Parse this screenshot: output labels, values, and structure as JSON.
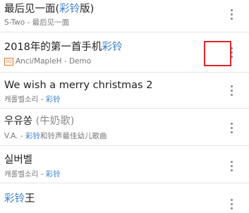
{
  "songs": [
    {
      "title_main": "最后见一面(",
      "title_hl": "彩铃",
      "title_tail": "版)",
      "subtitle_main": "S-Two - 最后见一面",
      "subtitle_hl": "",
      "subtitle_tail": ""
    },
    {
      "title_main": "2018年的第一首手机",
      "title_hl": "彩铃",
      "title_tail": "",
      "badge": "SQ",
      "subtitle_main": "Anci/MapleH - Demo",
      "subtitle_hl": "",
      "subtitle_tail": ""
    },
    {
      "title_main": "We wish a merry christmas 2",
      "title_hl": "",
      "title_tail": "",
      "subtitle_main": "캐롤벨소리 - ",
      "subtitle_hl": "彩铃",
      "subtitle_tail": ""
    },
    {
      "title_main": "우유쏭 ",
      "title_hl": "",
      "title_gray": "(牛奶歌)",
      "title_tail": "",
      "subtitle_main": "V.A. - ",
      "subtitle_hl": "彩铃",
      "subtitle_tail": "和铃声最佳幼儿歌曲"
    },
    {
      "title_main": "실버벨",
      "title_hl": "",
      "title_tail": "",
      "subtitle_main": "캐롤벨소리 - ",
      "subtitle_hl": "彩铃",
      "subtitle_tail": ""
    },
    {
      "title_main": "",
      "title_hl": "彩铃",
      "title_tail": "王",
      "subtitle_main": "",
      "subtitle_hl": "",
      "subtitle_tail": ""
    }
  ],
  "colors": {
    "highlight_text": "#3a7fd0",
    "annotation_box": "#e0262a"
  },
  "icons": {
    "more": "more-vertical-icon",
    "quality_badge": "sq-quality-badge"
  }
}
